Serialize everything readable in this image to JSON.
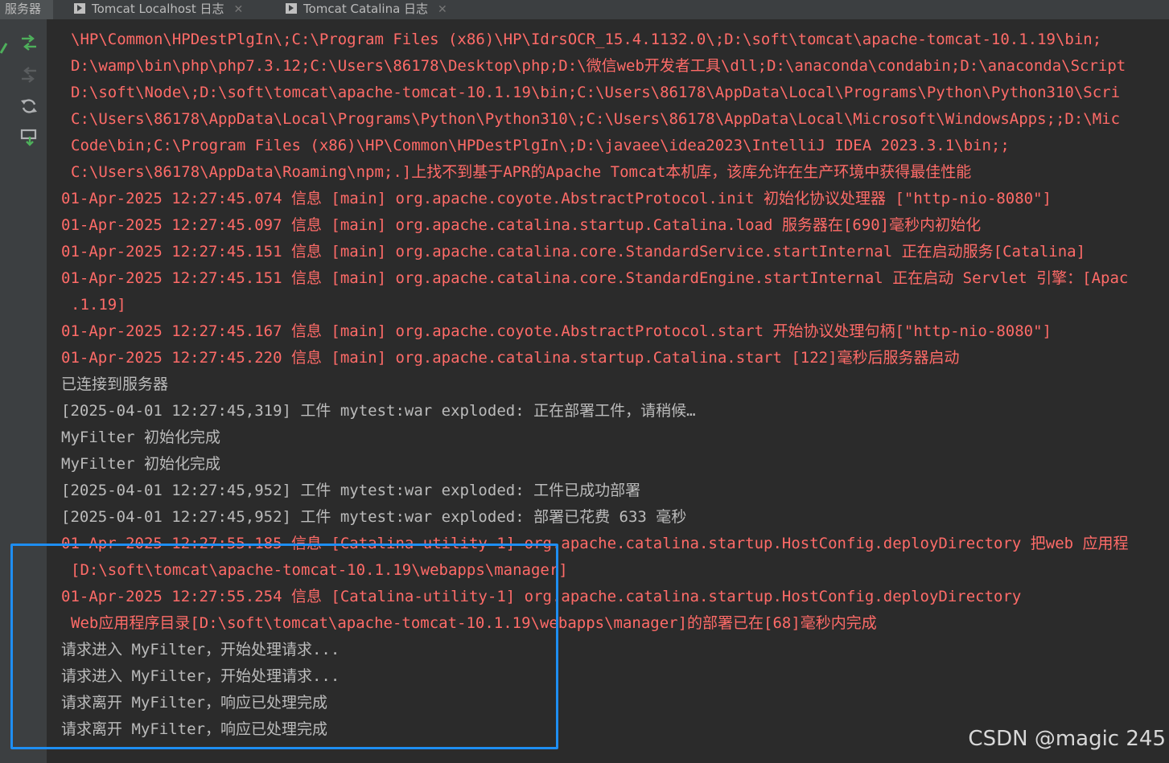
{
  "tabs": {
    "servers_label": "服务器",
    "items": [
      {
        "label": "Tomcat Localhost 日志",
        "close": "✕"
      },
      {
        "label": "Tomcat Catalina 日志",
        "close": "✕"
      }
    ]
  },
  "sidebar": {
    "icons": [
      "deploy-icon",
      "undeploy-icon",
      "refresh-icon",
      "export-icon"
    ],
    "accent": "#4eb05b"
  },
  "console": {
    "lines": [
      {
        "indent": 1,
        "kind": "err",
        "text": "\\HP\\Common\\HPDestPlgIn\\;C:\\Program Files (x86)\\HP\\IdrsOCR_15.4.1132.0\\;D:\\soft\\tomcat\\apache-tomcat-10.1.19\\bin;"
      },
      {
        "indent": 1,
        "kind": "err",
        "text": "D:\\wamp\\bin\\php\\php7.3.12;C:\\Users\\86178\\Desktop\\php;D:\\微信web开发者工具\\dll;D:\\anaconda\\condabin;D:\\anaconda\\Script"
      },
      {
        "indent": 1,
        "kind": "err",
        "text": "D:\\soft\\Node\\;D:\\soft\\tomcat\\apache-tomcat-10.1.19\\bin;C:\\Users\\86178\\AppData\\Local\\Programs\\Python\\Python310\\Scri"
      },
      {
        "indent": 1,
        "kind": "err",
        "text": "C:\\Users\\86178\\AppData\\Local\\Programs\\Python\\Python310\\;C:\\Users\\86178\\AppData\\Local\\Microsoft\\WindowsApps;;D:\\Mic"
      },
      {
        "indent": 1,
        "kind": "err",
        "text": "Code\\bin;C:\\Program Files (x86)\\HP\\Common\\HPDestPlgIn\\;D:\\javaee\\idea2023\\IntelliJ IDEA 2023.3.1\\bin;;"
      },
      {
        "indent": 1,
        "kind": "err",
        "text": "C:\\Users\\86178\\AppData\\Roaming\\npm;.]上找不到基于APR的Apache Tomcat本机库，该库允许在生产环境中获得最佳性能"
      },
      {
        "indent": 0,
        "kind": "err",
        "text": "01-Apr-2025 12:27:45.074 信息 [main] org.apache.coyote.AbstractProtocol.init 初始化协议处理器 [\"http-nio-8080\"]"
      },
      {
        "indent": 0,
        "kind": "err",
        "text": "01-Apr-2025 12:27:45.097 信息 [main] org.apache.catalina.startup.Catalina.load 服务器在[690]毫秒内初始化"
      },
      {
        "indent": 0,
        "kind": "err",
        "text": "01-Apr-2025 12:27:45.151 信息 [main] org.apache.catalina.core.StandardService.startInternal 正在启动服务[Catalina]"
      },
      {
        "indent": 0,
        "kind": "err",
        "text": "01-Apr-2025 12:27:45.151 信息 [main] org.apache.catalina.core.StandardEngine.startInternal 正在启动 Servlet 引擎：[Apac"
      },
      {
        "indent": 1,
        "kind": "err",
        "text": ".1.19]"
      },
      {
        "indent": 0,
        "kind": "err",
        "text": "01-Apr-2025 12:27:45.167 信息 [main] org.apache.coyote.AbstractProtocol.start 开始协议处理句柄[\"http-nio-8080\"]"
      },
      {
        "indent": 0,
        "kind": "err",
        "text": "01-Apr-2025 12:27:45.220 信息 [main] org.apache.catalina.startup.Catalina.start [122]毫秒后服务器启动"
      },
      {
        "indent": 0,
        "kind": "out",
        "text": "已连接到服务器"
      },
      {
        "indent": 0,
        "kind": "out",
        "text": "[2025-04-01 12:27:45,319] 工件 mytest:war exploded: 正在部署工件，请稍候…"
      },
      {
        "indent": 0,
        "kind": "out",
        "text": "MyFilter 初始化完成"
      },
      {
        "indent": 0,
        "kind": "out",
        "text": "MyFilter 初始化完成"
      },
      {
        "indent": 0,
        "kind": "out",
        "text": "[2025-04-01 12:27:45,952] 工件 mytest:war exploded: 工件已成功部署"
      },
      {
        "indent": 0,
        "kind": "out",
        "text": "[2025-04-01 12:27:45,952] 工件 mytest:war exploded: 部署已花费 633 毫秒"
      },
      {
        "indent": 0,
        "kind": "err",
        "text": "01-Apr-2025 12:27:55.185 信息 [Catalina-utility-1] org.apache.catalina.startup.HostConfig.deployDirectory 把web 应用程"
      },
      {
        "indent": 1,
        "kind": "err",
        "text": "[D:\\soft\\tomcat\\apache-tomcat-10.1.19\\webapps\\manager]"
      },
      {
        "indent": 0,
        "kind": "err",
        "text": "01-Apr-2025 12:27:55.254 信息 [Catalina-utility-1] org.apache.catalina.startup.HostConfig.deployDirectory"
      },
      {
        "indent": 1,
        "kind": "err",
        "text": "Web应用程序目录[D:\\soft\\tomcat\\apache-tomcat-10.1.19\\webapps\\manager]的部署已在[68]毫秒内完成"
      },
      {
        "indent": 0,
        "kind": "out",
        "text": "请求进入 MyFilter，开始处理请求..."
      },
      {
        "indent": 0,
        "kind": "out",
        "text": "请求进入 MyFilter，开始处理请求..."
      },
      {
        "indent": 0,
        "kind": "out",
        "text": "请求离开 MyFilter，响应已处理完成"
      },
      {
        "indent": 0,
        "kind": "out",
        "text": "请求离开 MyFilter，响应已处理完成"
      }
    ]
  },
  "colors": {
    "error_text": "#ff6b68",
    "normal_text": "#bbbbbb",
    "highlight": "#1e8ef2"
  },
  "watermark": "CSDN @magic 245"
}
